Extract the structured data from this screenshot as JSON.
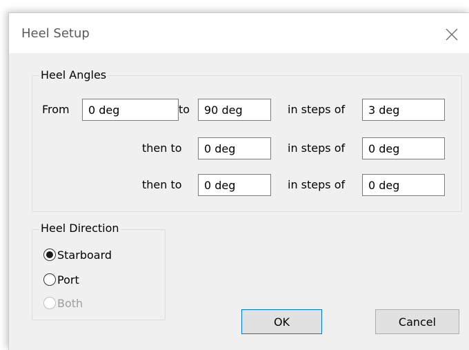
{
  "window": {
    "title": "Heel Setup",
    "close_icon": "close-icon"
  },
  "heel_angles": {
    "group_label": "Heel Angles",
    "from_label": "From",
    "from_value": "0 deg",
    "to_label": "to",
    "to_value": "90 deg",
    "steps_label": "in steps of",
    "step1_value": "3 deg",
    "then_to_label": "then to",
    "then_to_2_value": "0 deg",
    "step2_value": "0 deg",
    "then_to_3_value": "0 deg",
    "step3_value": "0 deg"
  },
  "heel_direction": {
    "group_label": "Heel Direction",
    "options": [
      {
        "label": "Starboard",
        "selected": true,
        "enabled": true
      },
      {
        "label": "Port",
        "selected": false,
        "enabled": true
      },
      {
        "label": "Both",
        "selected": false,
        "enabled": false
      }
    ]
  },
  "buttons": {
    "ok_label": "OK",
    "cancel_label": "Cancel"
  }
}
